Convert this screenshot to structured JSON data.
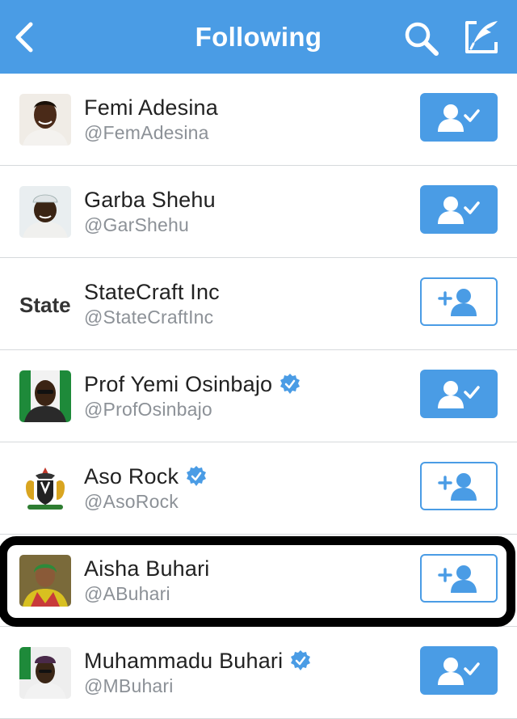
{
  "header": {
    "title": "Following",
    "accent_color": "#4a9ce5",
    "back_icon": "chevron-left-icon",
    "search_icon": "search-icon",
    "compose_icon": "compose-icon"
  },
  "users": [
    {
      "name": "Femi Adesina",
      "handle": "@FemAdesina",
      "verified": false,
      "following": true
    },
    {
      "name": "Garba Shehu",
      "handle": "@GarShehu",
      "verified": false,
      "following": true
    },
    {
      "name": "StateCraft Inc",
      "handle": "@StateCraftInc",
      "verified": false,
      "following": false,
      "avatar_text": "State"
    },
    {
      "name": "Prof Yemi Osinbajo",
      "handle": "@ProfOsinbajo",
      "verified": true,
      "following": true
    },
    {
      "name": "Aso Rock",
      "handle": "@AsoRock",
      "verified": true,
      "following": false
    },
    {
      "name": "Aisha Buhari",
      "handle": "@ABuhari",
      "verified": false,
      "following": false,
      "highlighted": true
    },
    {
      "name": "Muhammadu Buhari",
      "handle": "@MBuhari",
      "verified": true,
      "following": true
    }
  ]
}
